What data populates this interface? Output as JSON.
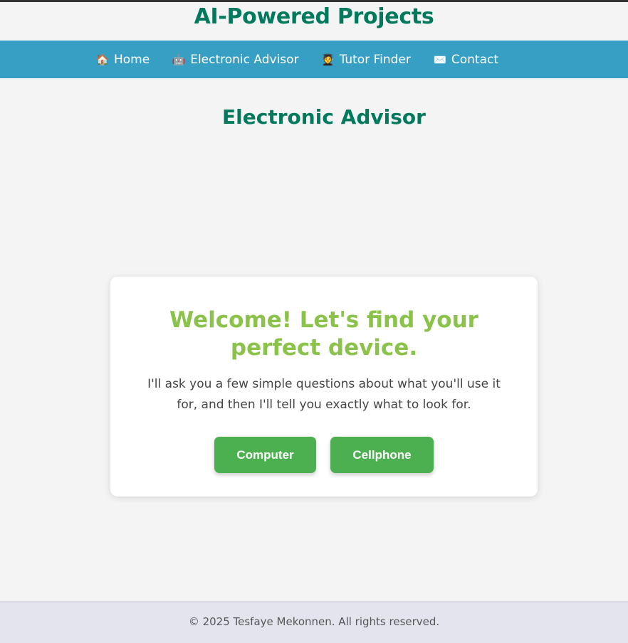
{
  "header": {
    "title": "AI-Powered Projects"
  },
  "nav": {
    "items": [
      {
        "icon": "🏠",
        "icon_name": "home-icon",
        "label": "Home"
      },
      {
        "icon": "🤖",
        "icon_name": "robot-icon",
        "label": "Electronic Advisor"
      },
      {
        "icon": "🧑‍🎓",
        "icon_name": "student-icon",
        "label": "Tutor Finder"
      },
      {
        "icon": "✉️",
        "icon_name": "envelope-icon",
        "label": "Contact"
      }
    ]
  },
  "main": {
    "heading": "Electronic Advisor",
    "card": {
      "title": "Welcome! Let's find your perfect device.",
      "text": "I'll ask you a few simple questions about what you'll use it for, and then I'll tell you exactly what to look for.",
      "buttons": {
        "computer": "Computer",
        "cellphone": "Cellphone"
      }
    }
  },
  "footer": {
    "text": "© 2025 Tesfaye Mekonnen. All rights reserved."
  },
  "colors": {
    "brand_green": "#00795c",
    "nav_blue": "#369fc3",
    "accent_light_green": "#8bc34a",
    "button_green": "#4caf50"
  }
}
